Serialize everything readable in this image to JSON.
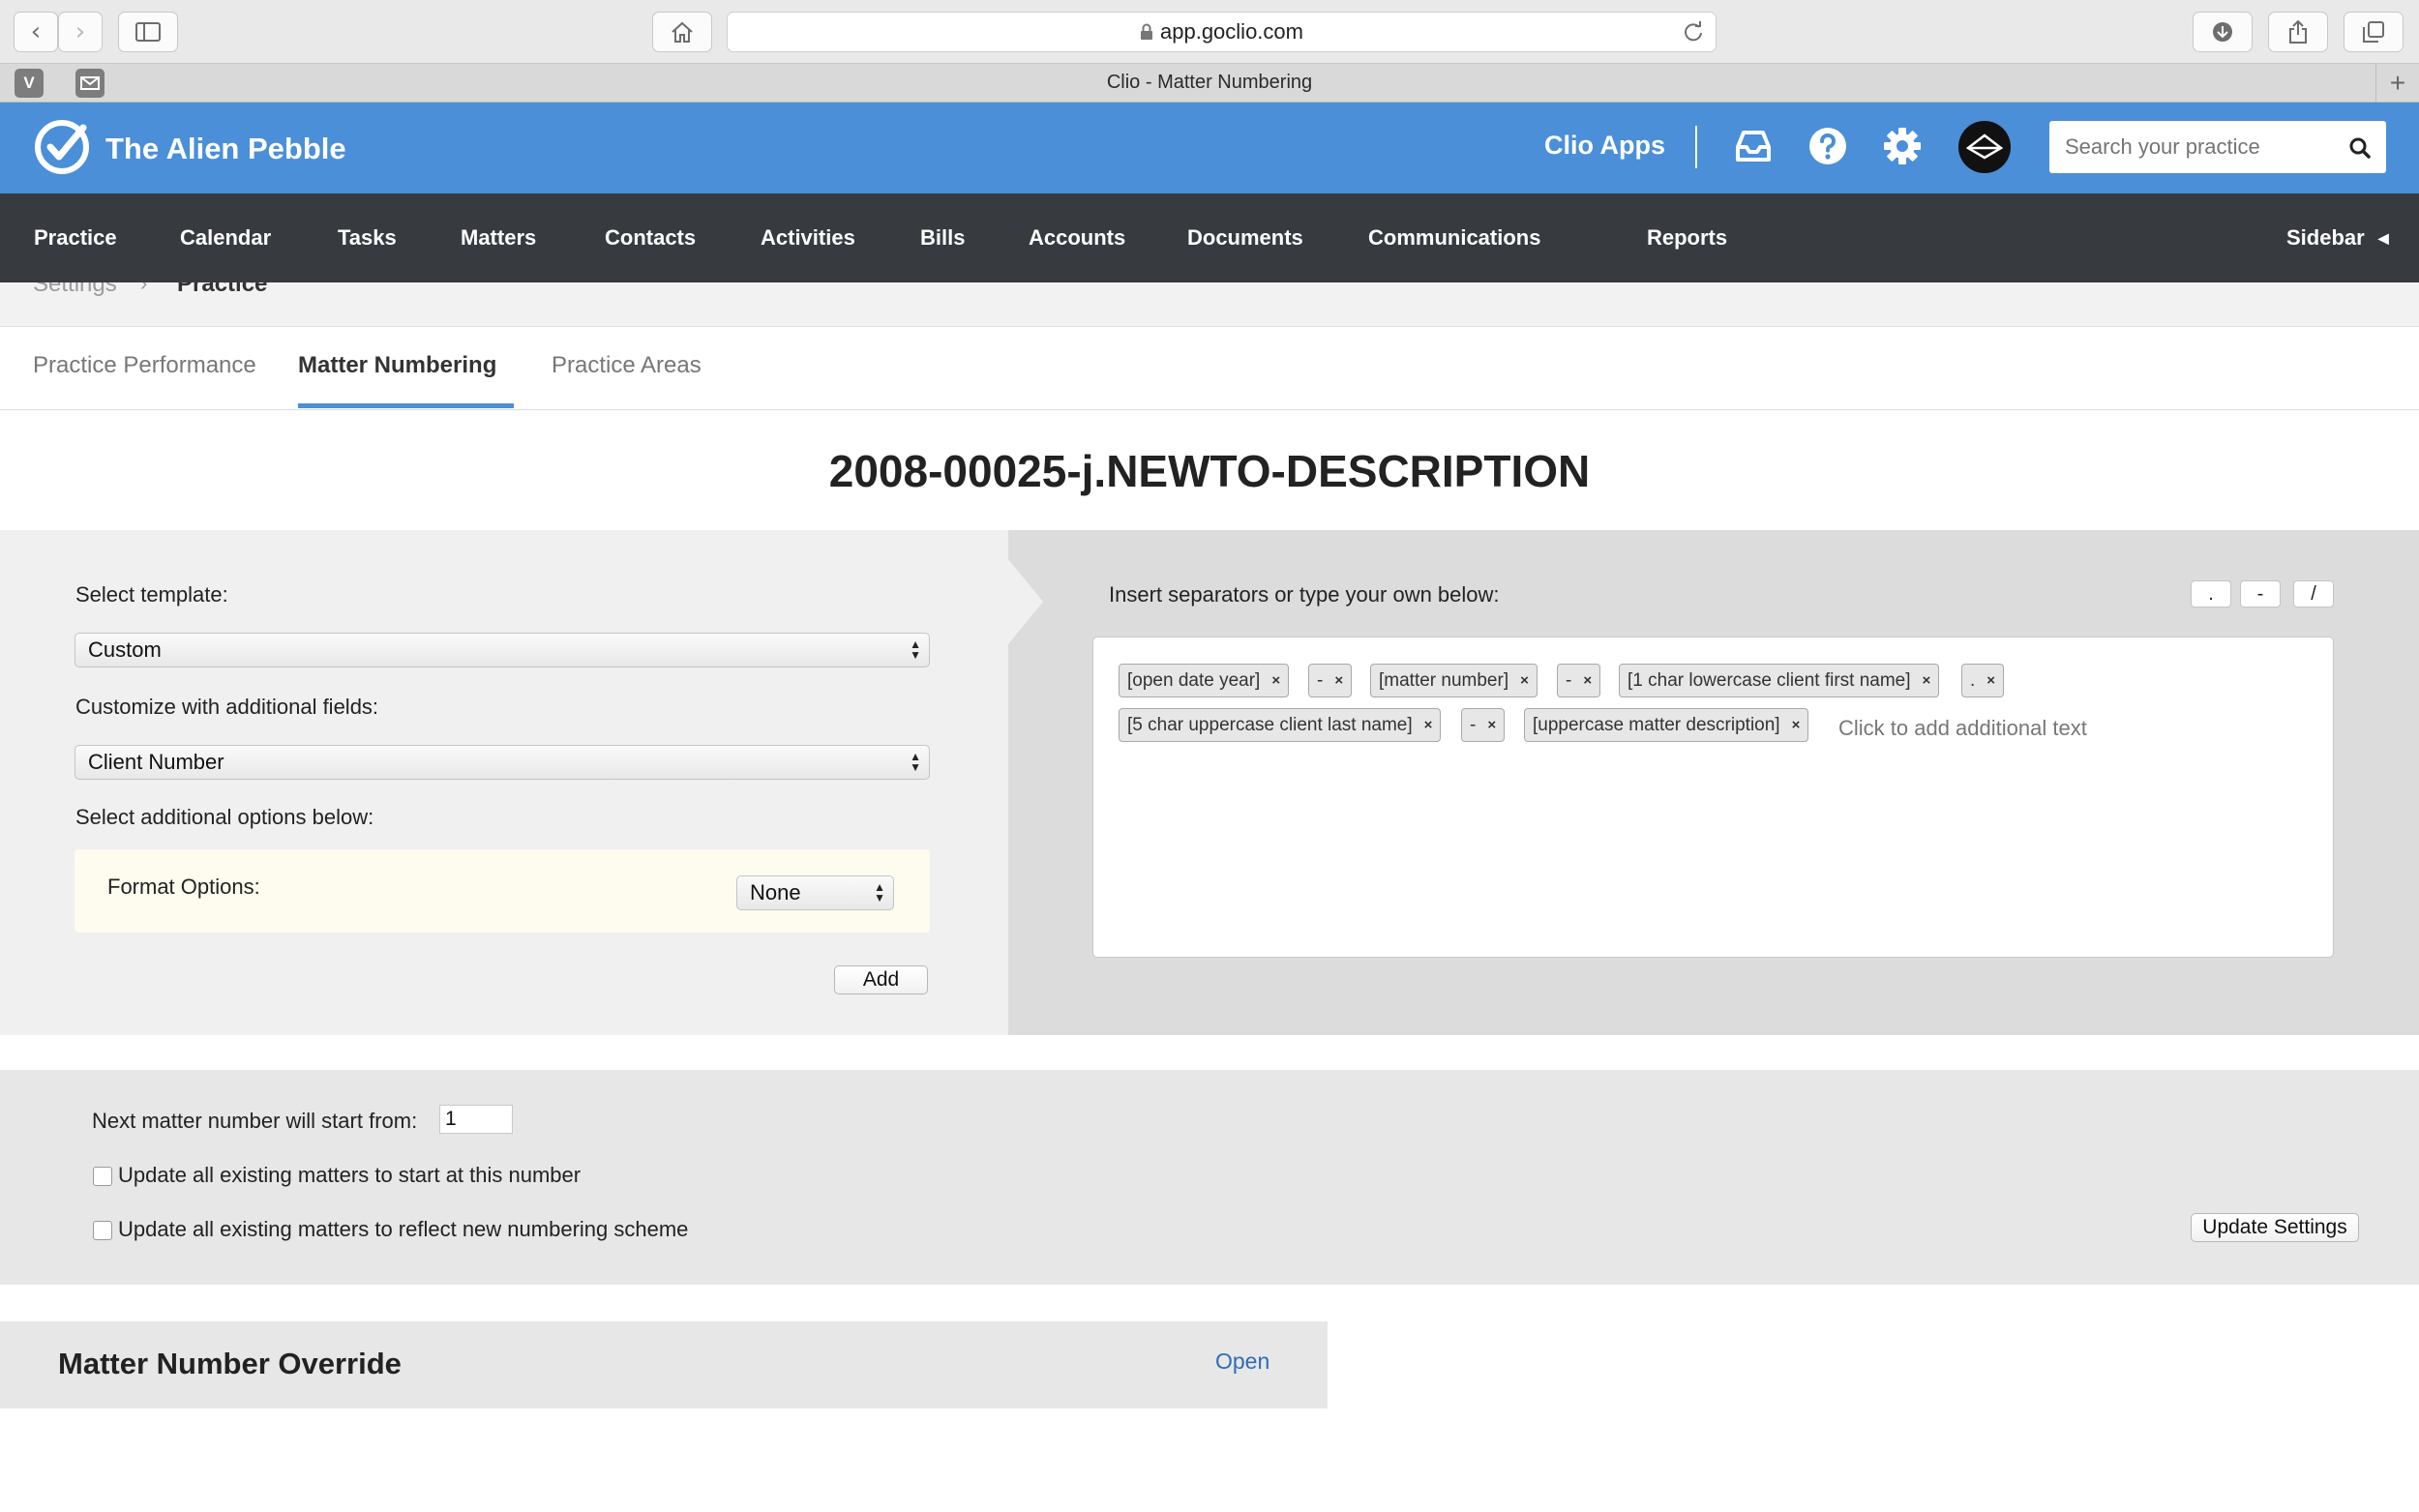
{
  "browser": {
    "url": "app.goclio.com",
    "tab_title": "Clio - Matter Numbering"
  },
  "header": {
    "app_name": "The Alien Pebble",
    "clio_apps": "Clio Apps",
    "search_placeholder": "Search your practice",
    "brand_color": "#4a8fd8"
  },
  "nav": {
    "items": [
      "Practice",
      "Calendar",
      "Tasks",
      "Matters",
      "Contacts",
      "Activities",
      "Bills",
      "Accounts",
      "Documents",
      "Communications",
      "Reports"
    ],
    "sidebar": "Sidebar"
  },
  "breadcrumb": {
    "parent": "Settings",
    "current": "Practice"
  },
  "tabs": [
    {
      "label": "Practice Performance",
      "active": false
    },
    {
      "label": "Matter Numbering",
      "active": true
    },
    {
      "label": "Practice Areas",
      "active": false
    }
  ],
  "preview_number": "2008-00025-j.NEWTO-DESCRIPTION",
  "left_panel": {
    "template_label": "Select template:",
    "template_value": "Custom",
    "customize_label": "Customize with additional fields:",
    "customize_value": "Client Number",
    "options_label": "Select additional options below:",
    "format_label": "Format Options:",
    "format_value": "None",
    "add_button": "Add"
  },
  "right_panel": {
    "instruction": "Insert separators or type your own below:",
    "separators": [
      ".",
      "-",
      "/"
    ],
    "chips_row1": [
      "[open date year]",
      "-",
      "[matter number]",
      "-",
      "[1 char lowercase client first name]",
      "."
    ],
    "chips_row2": [
      "[5 char uppercase client last name]",
      "-",
      "[uppercase matter description]"
    ],
    "remove_glyph": "×",
    "add_text_placeholder": "Click to add additional text"
  },
  "settings": {
    "next_label": "Next matter number will start from:",
    "next_value": "1",
    "update_start_label": "Update all existing matters to start at this number",
    "update_scheme_label": "Update all existing matters to reflect new numbering scheme",
    "update_button": "Update Settings"
  },
  "override": {
    "title": "Matter Number Override",
    "open_link": "Open"
  }
}
